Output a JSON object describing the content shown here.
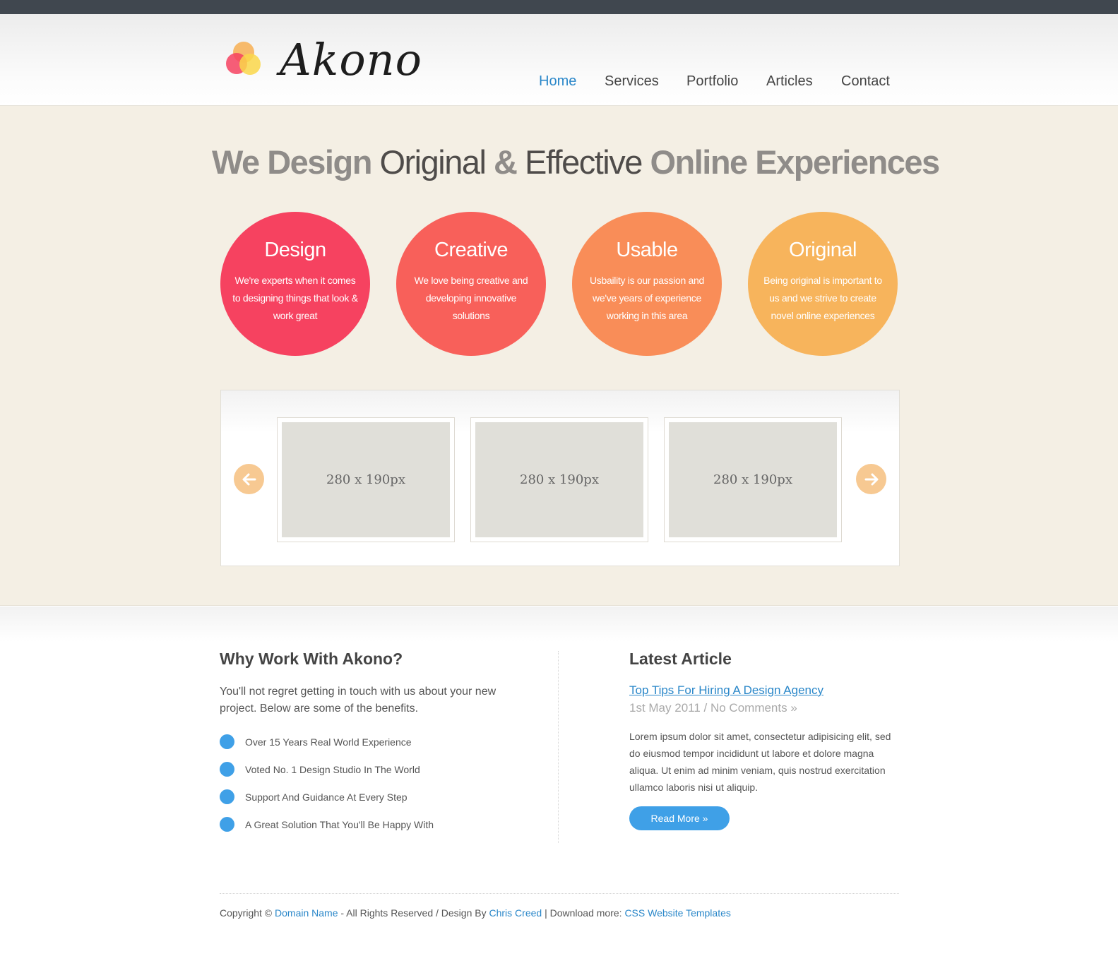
{
  "brand": {
    "name": "Akono"
  },
  "nav": [
    {
      "label": "Home",
      "active": true
    },
    {
      "label": "Services",
      "active": false
    },
    {
      "label": "Portfolio",
      "active": false
    },
    {
      "label": "Articles",
      "active": false
    },
    {
      "label": "Contact",
      "active": false
    }
  ],
  "hero": {
    "tagline": {
      "p1": "We Design ",
      "b1": "Original",
      "p2": " & ",
      "b2": "Effective",
      "p3": " Online Experiences"
    },
    "circles": [
      {
        "title": "Design",
        "text": "We're experts when it comes to designing things that look & work great",
        "color": "#f64260"
      },
      {
        "title": "Creative",
        "text": "We love being creative and developing innovative solutions",
        "color": "#f8605a"
      },
      {
        "title": "Usable",
        "text": "Usbaility is our passion and we've years of experience working in this area",
        "color": "#f98d58"
      },
      {
        "title": "Original",
        "text": "Being original is important to us and we strive to create novel online experiences",
        "color": "#f7b45c"
      }
    ]
  },
  "slider": {
    "prev_icon": "arrow-left-icon",
    "next_icon": "arrow-right-icon",
    "items": [
      {
        "label": "280 x 190px"
      },
      {
        "label": "280 x 190px"
      },
      {
        "label": "280 x 190px"
      }
    ]
  },
  "why": {
    "title": "Why Work With Akono?",
    "intro": "You'll not regret getting in touch with us about your new project. Below are some of the benefits.",
    "items": [
      "Over 15 Years Real World Experience",
      "Voted No. 1 Design Studio In The World",
      "Support And Guidance At Every Step",
      "A Great Solution That You'll Be Happy With"
    ]
  },
  "article": {
    "title": "Latest Article",
    "link": "Top Tips For Hiring A Design Agency",
    "meta": "1st May 2011 / No Comments »",
    "body": "Lorem ipsum dolor sit amet, consectetur adipisicing elit, sed do eiusmod tempor incididunt ut labore et dolore magna aliqua. Ut enim ad minim veniam, quis nostrud exercitation ullamco laboris nisi ut aliquip.",
    "button": "Read More »"
  },
  "footer": {
    "p1": "Copyright © ",
    "l1": "Domain Name",
    "p2": " - All Rights Reserved / Design By ",
    "l2": "Chris Creed",
    "p3": " | Download more: ",
    "l3": "CSS Website Templates"
  },
  "colors": {
    "accent": "#2a87c9",
    "bullet": "#3fa0e7",
    "hero_bg": "#f4efe4",
    "arrow": "#f7c992",
    "topbar": "#40474f"
  }
}
